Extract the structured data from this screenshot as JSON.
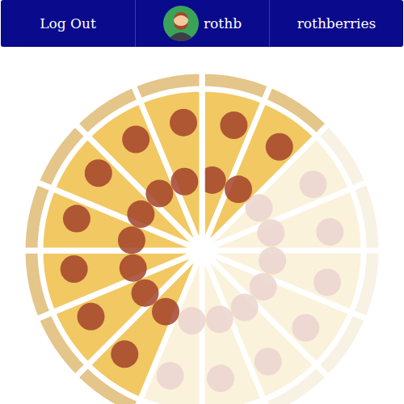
{
  "nav": {
    "items": [
      {
        "label": "Log Out",
        "kind": "link"
      },
      {
        "label": "rothb",
        "kind": "profile"
      },
      {
        "label": "rothberries",
        "kind": "link"
      }
    ]
  },
  "pizza": {
    "slices": [
      {
        "filled": true
      },
      {
        "filled": true
      },
      {
        "filled": false
      },
      {
        "filled": false
      },
      {
        "filled": false
      },
      {
        "filled": false
      },
      {
        "filled": false
      },
      {
        "filled": false
      },
      {
        "filled": false
      },
      {
        "filled": true
      },
      {
        "filled": true
      },
      {
        "filled": true
      },
      {
        "filled": true
      },
      {
        "filled": true
      },
      {
        "filled": true
      },
      {
        "filled": true
      }
    ]
  }
}
